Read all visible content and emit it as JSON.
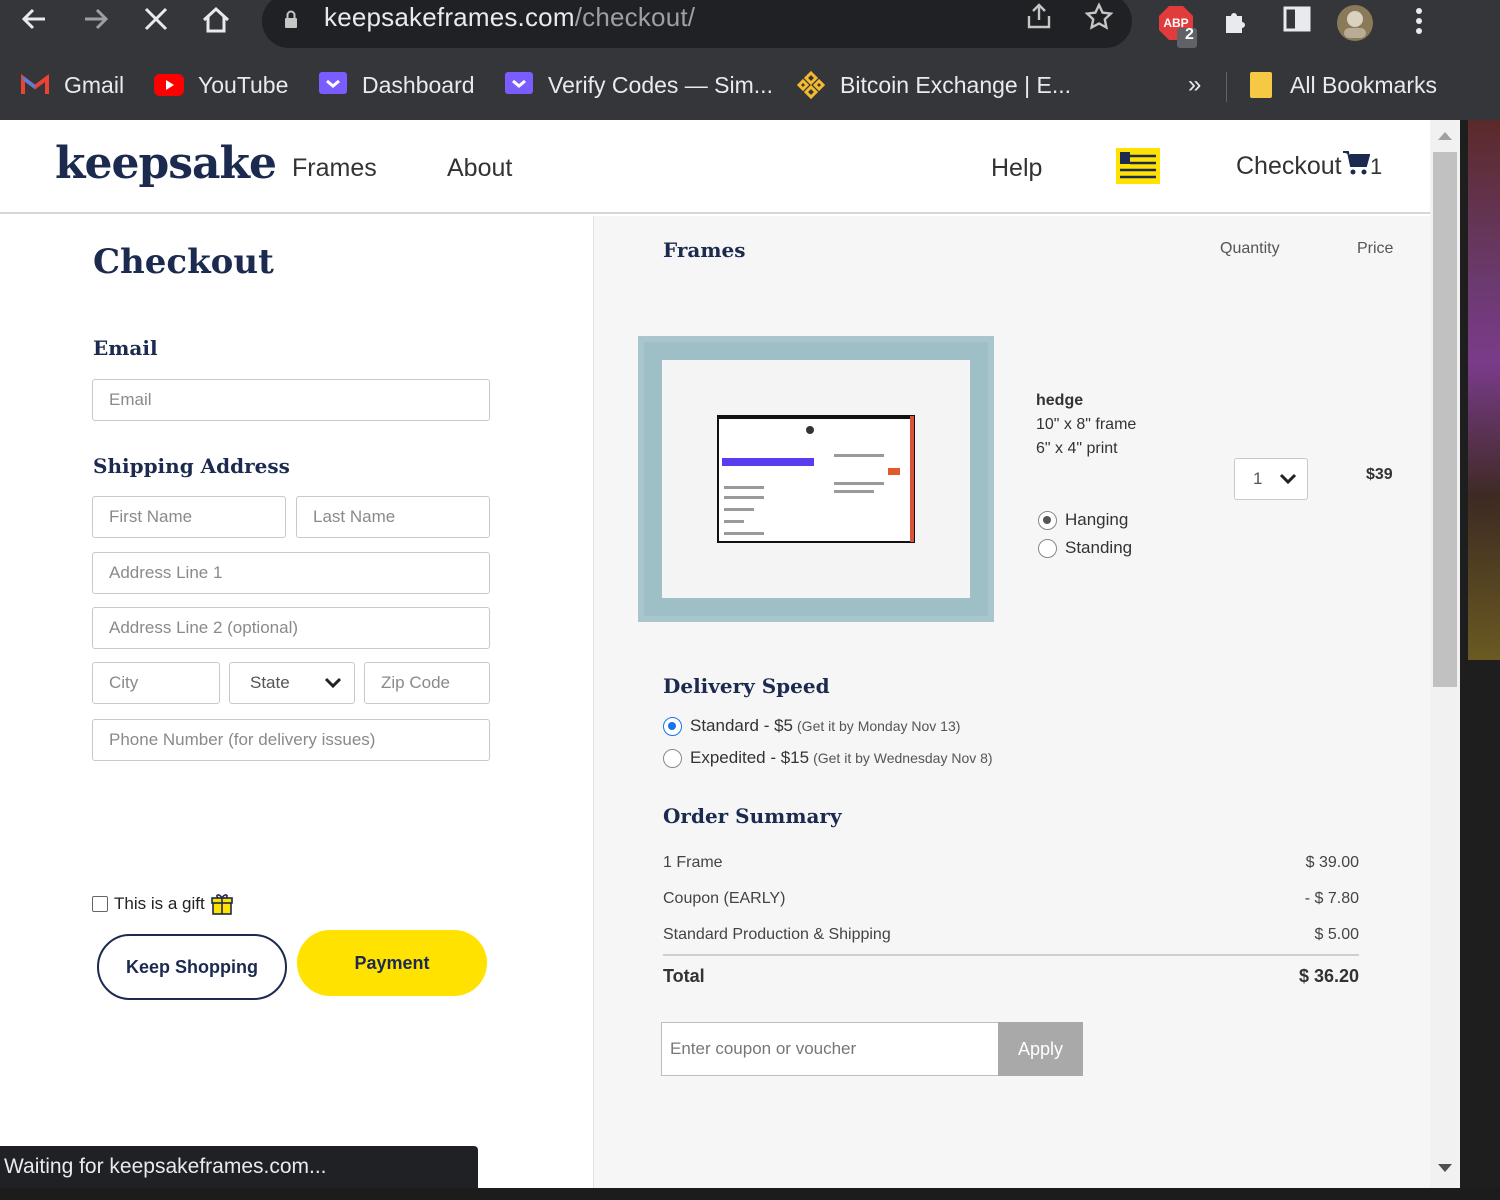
{
  "browser": {
    "url_host": "keepsakeframes.com",
    "url_path": "/checkout/",
    "extension_badge": "2",
    "bookmarks": [
      {
        "label": "Gmail",
        "icon": "gmail-icon"
      },
      {
        "label": "YouTube",
        "icon": "youtube-icon"
      },
      {
        "label": "Dashboard",
        "icon": "dashboard-icon"
      },
      {
        "label": "Verify Codes — Sim...",
        "icon": "verify-icon"
      },
      {
        "label": "Bitcoin Exchange | E...",
        "icon": "binance-icon"
      }
    ],
    "overflow_label": "»",
    "all_bookmarks": "All Bookmarks",
    "status_text": "Waiting for keepsakeframes.com..."
  },
  "header": {
    "logo": "keepsake",
    "nav": {
      "frames": "Frames",
      "about": "About",
      "help": "Help"
    },
    "checkout": "Checkout",
    "cart_count": "1"
  },
  "form": {
    "title": "Checkout",
    "email_title": "Email",
    "email_placeholder": "Email",
    "shipping_title": "Shipping Address",
    "first_name": "First Name",
    "last_name": "Last Name",
    "address1": "Address Line 1",
    "address2": "Address Line 2 (optional)",
    "city": "City",
    "state": "State",
    "zip": "Zip Code",
    "phone": "Phone Number (for delivery issues)",
    "gift_label": "This is a gift",
    "keep_shopping": "Keep Shopping",
    "payment": "Payment"
  },
  "cart": {
    "frames_title": "Frames",
    "quantity_head": "Quantity",
    "price_head": "Price",
    "item": {
      "name": "hedge",
      "frame_size": "10\" x 8\" frame",
      "print_size": "6\" x 4\" print",
      "mount_options": [
        "Hanging",
        "Standing"
      ],
      "selected_mount": "Hanging",
      "quantity": "1",
      "price": "$39"
    }
  },
  "delivery": {
    "title": "Delivery Speed",
    "options": [
      {
        "label": "Standard - $5",
        "note": "(Get it by Monday Nov 13)",
        "selected": true
      },
      {
        "label": "Expedited - $15",
        "note": "(Get it by Wednesday Nov 8)",
        "selected": false
      }
    ]
  },
  "summary": {
    "title": "Order Summary",
    "rows": [
      {
        "label": "1 Frame",
        "amount": "$ 39.00"
      },
      {
        "label": "Coupon (EARLY)",
        "amount": "- $ 7.80"
      },
      {
        "label": "Standard Production & Shipping",
        "amount": "$ 5.00"
      }
    ],
    "total_label": "Total",
    "total_amount": "$ 36.20",
    "coupon_placeholder": "Enter coupon or voucher",
    "apply": "Apply"
  },
  "colors": {
    "brand_navy": "#1b2a4e",
    "accent_yellow": "#ffe200",
    "radio_blue": "#1a73e8"
  }
}
